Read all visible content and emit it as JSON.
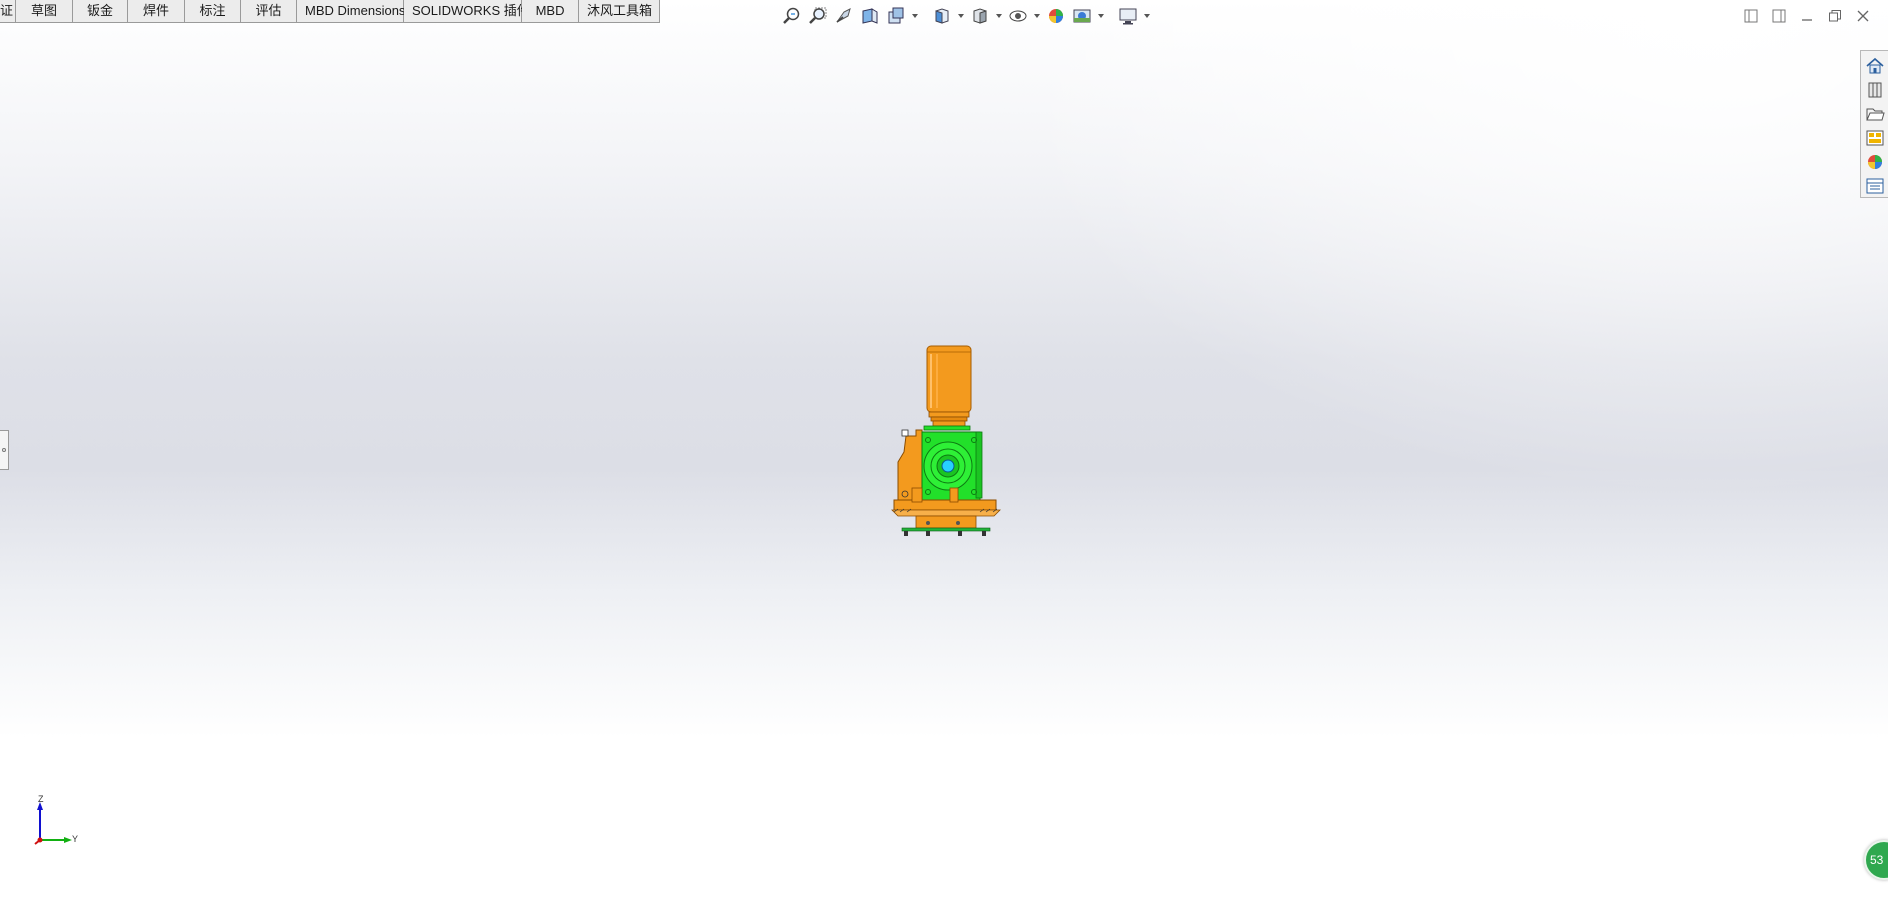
{
  "command_tabs": [
    {
      "label": "证",
      "active": false
    },
    {
      "label": "草图",
      "active": false
    },
    {
      "label": "钣金",
      "active": false
    },
    {
      "label": "焊件",
      "active": false
    },
    {
      "label": "标注",
      "active": false
    },
    {
      "label": "评估",
      "active": false
    },
    {
      "label": "MBD Dimensions",
      "active": false
    },
    {
      "label": "SOLIDWORKS 插件",
      "active": false
    },
    {
      "label": "MBD",
      "active": false
    },
    {
      "label": "沐风工具箱",
      "active": false
    }
  ],
  "hud_toolbar": [
    "zoom-to-fit-icon",
    "zoom-to-area-icon",
    "previous-view-icon",
    "section-view-icon",
    "dynamic-annotation-icon",
    "view-orientation-icon",
    "display-style-icon",
    "hide-show-items-icon",
    "edit-appearance-icon",
    "apply-scene-icon",
    "view-settings-icon"
  ],
  "task_pane": [
    "solidworks-resources-icon",
    "design-library-icon",
    "file-explorer-icon",
    "view-palette-icon",
    "appearances-icon",
    "custom-properties-icon"
  ],
  "triad": {
    "z_label": "Z",
    "y_label": "Y"
  },
  "badge": {
    "text": "53"
  },
  "colors": {
    "motor": "#f39a1e",
    "gearbox": "#22e02a",
    "accent_blue": "#1b7fd6"
  }
}
